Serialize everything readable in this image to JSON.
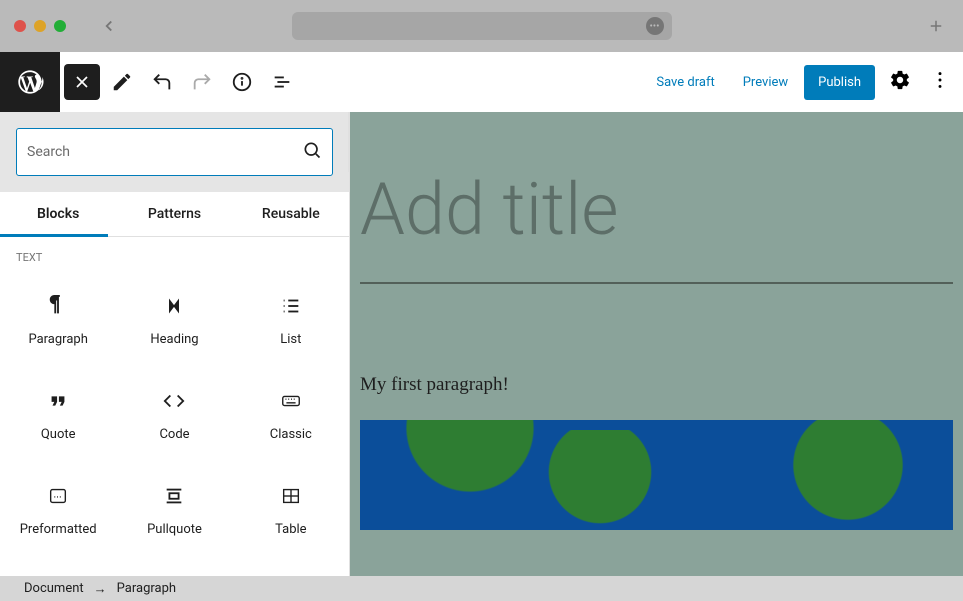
{
  "toolbar": {
    "save_draft": "Save draft",
    "preview": "Preview",
    "publish": "Publish"
  },
  "inserter": {
    "search_placeholder": "Search",
    "tabs": {
      "blocks": "Blocks",
      "patterns": "Patterns",
      "reusable": "Reusable"
    },
    "section_label": "TEXT",
    "blocks": {
      "paragraph": "Paragraph",
      "heading": "Heading",
      "list": "List",
      "quote": "Quote",
      "code": "Code",
      "classic": "Classic",
      "preformatted": "Preformatted",
      "pullquote": "Pullquote",
      "table": "Table"
    }
  },
  "editor": {
    "title_placeholder": "Add title",
    "paragraph_text": "My first paragraph!"
  },
  "breadcrumb": {
    "root": "Document",
    "current": "Paragraph"
  }
}
